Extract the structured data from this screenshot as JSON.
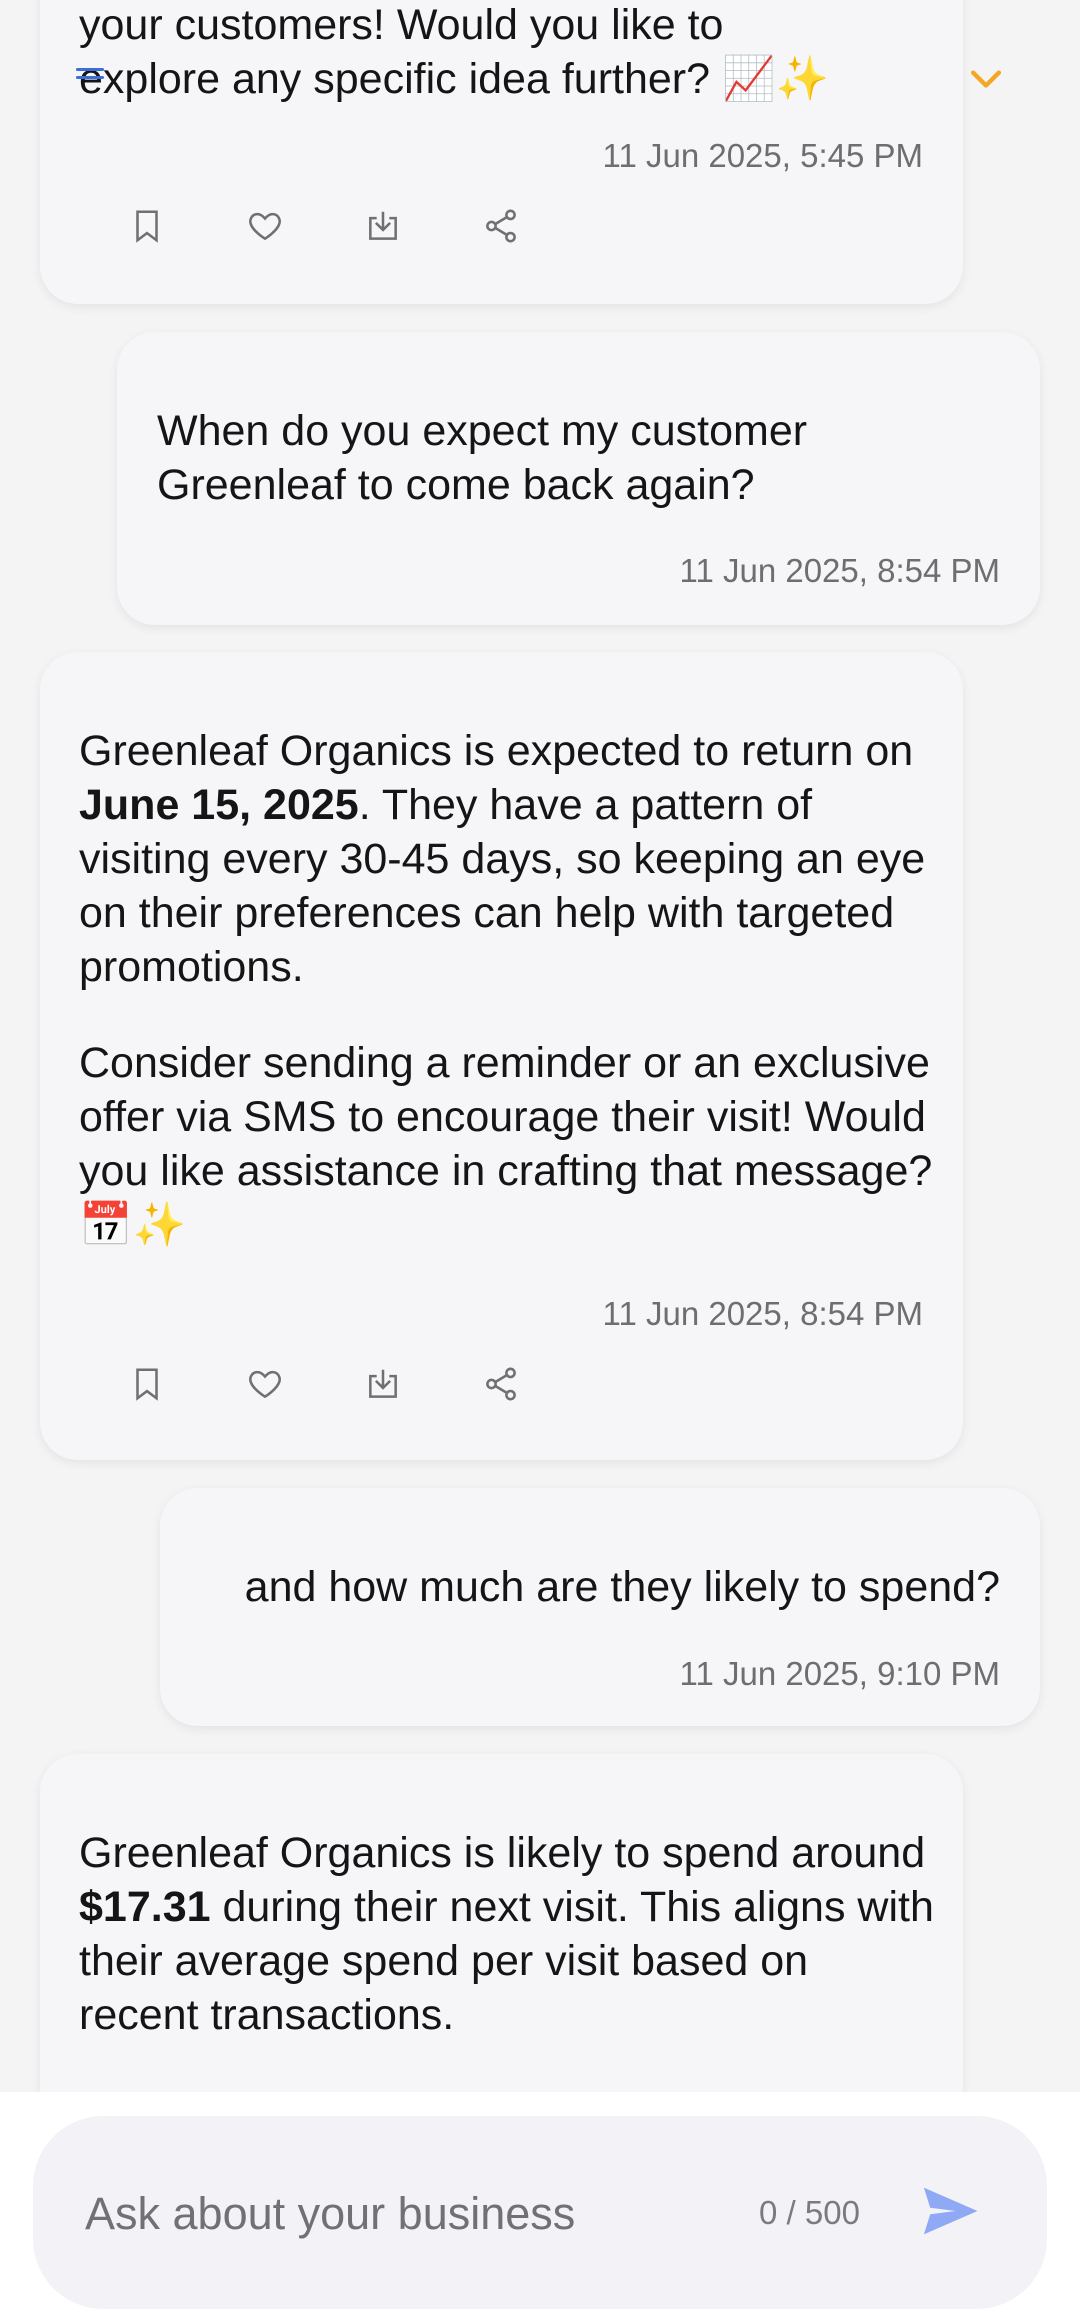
{
  "messages": {
    "m1": {
      "text_line1": "your customers! Would you like to",
      "text_line2": "explore any specific idea further?",
      "emojis": "📈✨",
      "time": "11 Jun 2025, 5:45 PM"
    },
    "m2": {
      "text": "When do you expect my customer Greenleaf to come back again?",
      "time": "11 Jun 2025, 8:54 PM"
    },
    "m3": {
      "p1_pre": "Greenleaf Organics is expected to return on ",
      "p1_bold": "June 15, 2025",
      "p1_post": ". They have a pattern of visiting every 30-45 days, so keeping an eye on their preferences can help with targeted promotions.",
      "p2": "Consider sending a reminder or an exclusive offer via SMS to encourage their visit! Would you like assistance in crafting that message?",
      "emojis": "📅✨",
      "time": "11 Jun 2025, 8:54 PM"
    },
    "m4": {
      "text": "and how much are they likely to spend?",
      "time": "11 Jun 2025, 9:10 PM"
    },
    "m5": {
      "p1_pre": "Greenleaf Organics is likely to spend around ",
      "p1_bold": "$17.31",
      "p1_post": " during their next visit. This aligns with their average spend per visit based on recent transactions."
    }
  },
  "icons": {
    "actions": [
      "bookmark-icon",
      "heart-icon",
      "download-icon",
      "share-icon"
    ],
    "collapse": "collapse-lines-icon",
    "scroll": "chevron-down-icon",
    "send": "send-icon"
  },
  "composer": {
    "placeholder": "Ask about your business",
    "counter": "0 / 500"
  },
  "colors": {
    "accent_orange": "#f5a623",
    "send_blue": "#8fa9f5",
    "collapse_blue": "#3b6fd8",
    "bubble_bg": "#f6f6f9",
    "page_bg": "#f4f4f5"
  }
}
